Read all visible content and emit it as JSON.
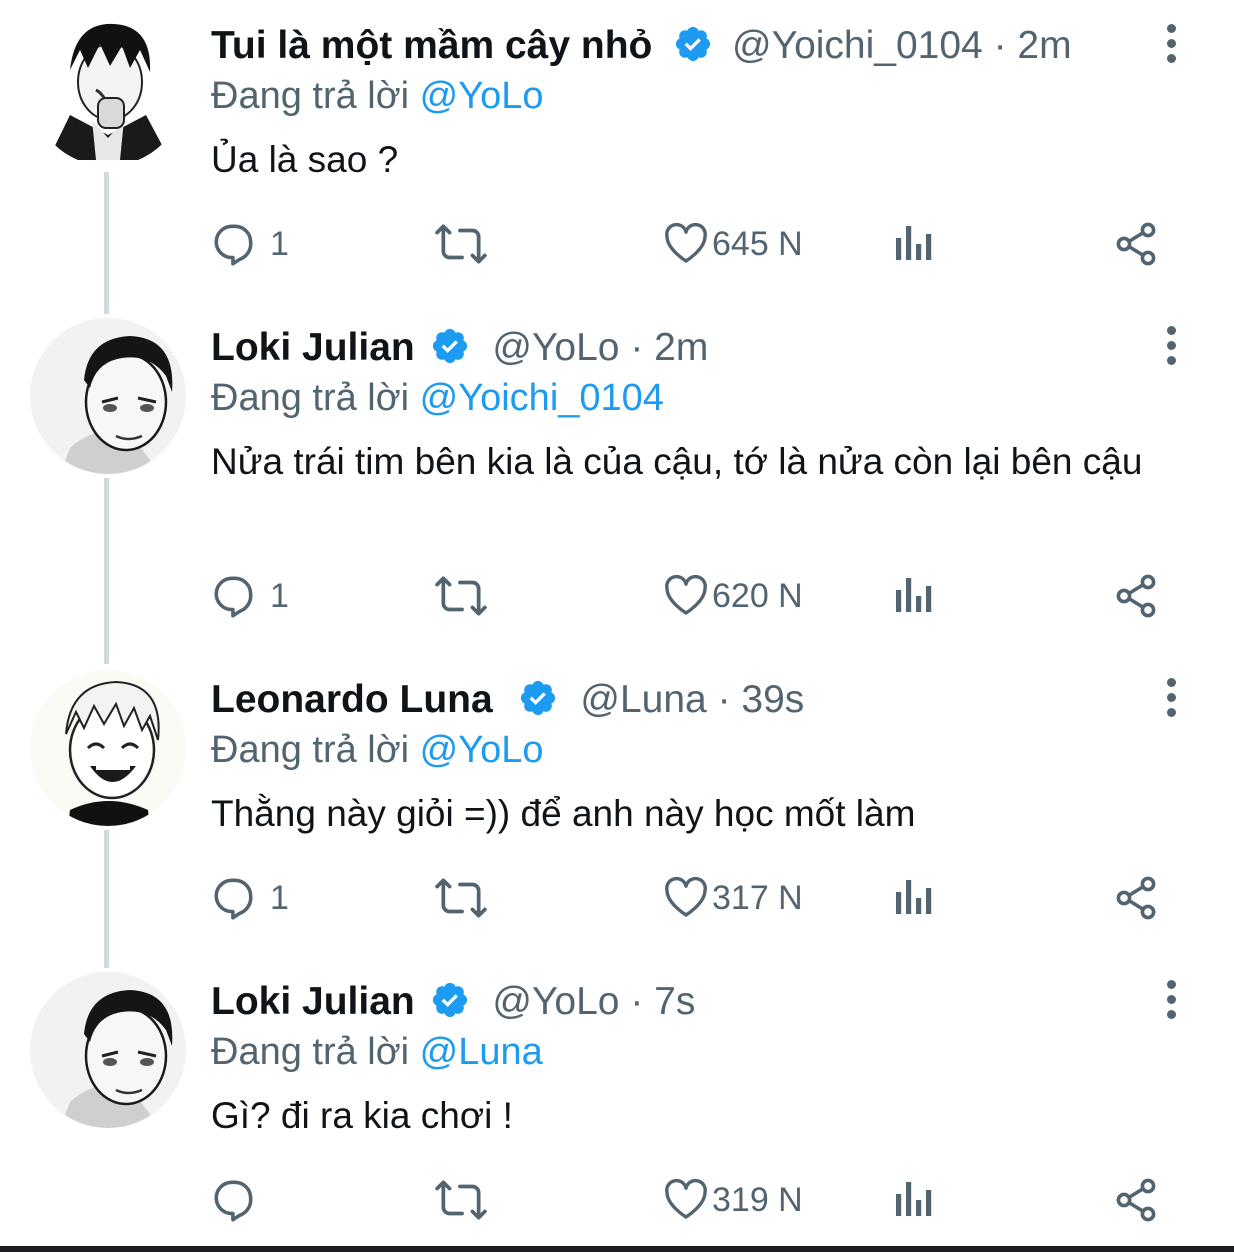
{
  "reply_prefix": "Đang trả lời",
  "tweets": [
    {
      "author": "Tui là một mầm cây nhỏ",
      "handle": "@Yoichi_0104",
      "time": "2m",
      "reply_to": "@YoLo",
      "text": "Ủa là sao ?",
      "replies": "1",
      "retweets": "",
      "likes": "645 N"
    },
    {
      "author": "Loki Julian",
      "handle": "@YoLo",
      "time": "2m",
      "reply_to": "@Yoichi_0104",
      "text": "Nửa trái tim bên kia là của cậu, tớ là nửa còn lại bên cậu",
      "replies": "1",
      "retweets": "",
      "likes": "620 N"
    },
    {
      "author": "Leonardo Luna",
      "handle": "@Luna",
      "time": "39s",
      "reply_to": "@YoLo",
      "text": "Thằng này giỏi =)) để anh này học mốt làm",
      "replies": "1",
      "retweets": "",
      "likes": "317 N"
    },
    {
      "author": "Loki Julian",
      "handle": "@YoLo",
      "time": "7s",
      "reply_to": "@Luna",
      "text": "Gì? đi ra kia chơi !",
      "replies": "",
      "retweets": "",
      "likes": "319 N"
    }
  ],
  "icons": {
    "verified": "verified-badge-icon",
    "reply": "reply-bubble-icon",
    "retweet": "retweet-icon",
    "like": "heart-icon",
    "views": "views-chart-icon",
    "share": "share-icon",
    "more": "more-vertical-icon"
  },
  "colors": {
    "accent": "#1d9bf0",
    "muted": "#536471",
    "text": "#0f1419",
    "thread": "#cfd9de"
  }
}
